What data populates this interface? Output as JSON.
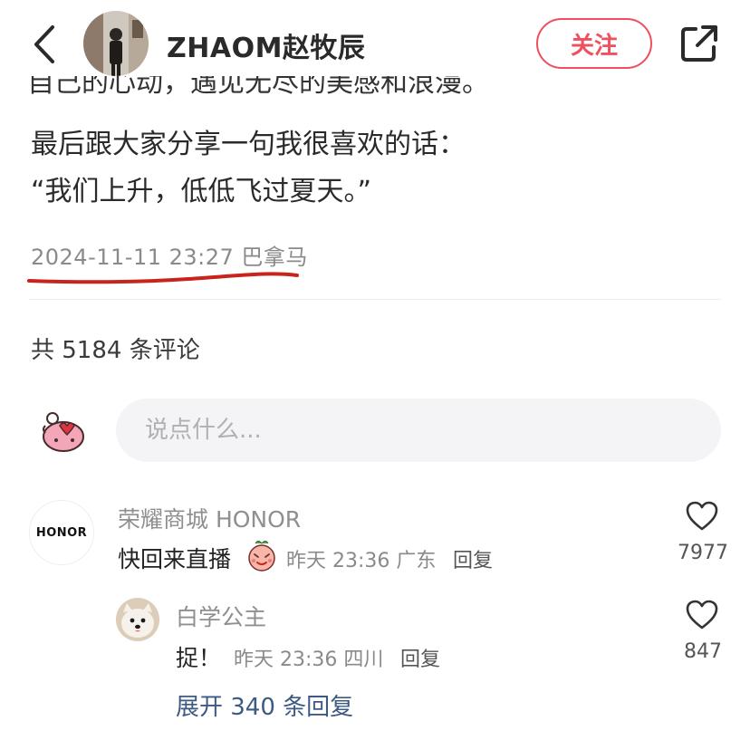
{
  "header": {
    "author_name": "ZHAOM赵牧辰",
    "follow_label": "关注"
  },
  "post": {
    "clipped_line": "自己的心动，遇见无尽的美感和浪漫。",
    "lines": [
      "最后跟大家分享一句我很喜欢的话：",
      "“我们上升，低低飞过夏天。”"
    ],
    "timestamp": "2024-11-11 23:27",
    "location": "巴拿马"
  },
  "comments_header": {
    "count_text": "共 5184 条评论"
  },
  "composer": {
    "placeholder": "说点什么..."
  },
  "comments": [
    {
      "avatar_text": "HONOR",
      "username": "荣耀商城 HONOR",
      "text": "快回来直播",
      "time": "昨天 23:36",
      "location": "广东",
      "reply_label": "回复",
      "likes": "7977"
    },
    {
      "username": "白学公主",
      "text": "捉！",
      "time": "昨天 23:36",
      "location": "四川",
      "reply_label": "回复",
      "likes": "847"
    }
  ],
  "expand": {
    "label": "展开 340 条回复"
  },
  "icons": {
    "back": "back-arrow-icon",
    "share": "share-icon",
    "like": "heart-icon"
  },
  "colors": {
    "accent": "#ef4f5f",
    "link": "#3d5a84",
    "annotation": "#c8241c"
  }
}
